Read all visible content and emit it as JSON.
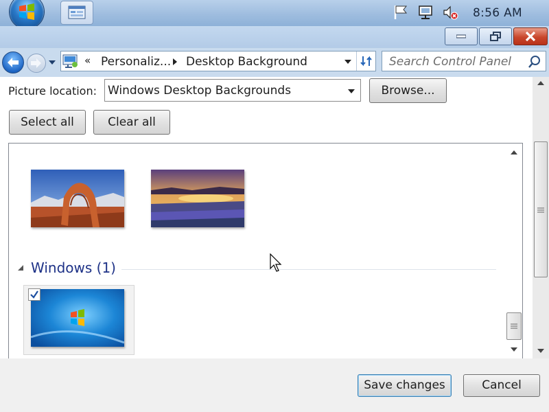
{
  "taskbar": {
    "clock": "8:56 AM",
    "start_icon": "windows-start-orb",
    "pinned_icon": "control-panel-window-icon",
    "tray_icons": [
      "flag-icon",
      "network-icon",
      "volume-muted-icon"
    ]
  },
  "window": {
    "minimize_icon": "minimize-icon",
    "maximize_icon": "restore-icon",
    "close_icon": "close-icon"
  },
  "address": {
    "overflow": "«",
    "segments": [
      "Personaliz...",
      "Desktop Background"
    ]
  },
  "search": {
    "placeholder": "Search Control Panel"
  },
  "picture_location": {
    "label": "Picture location:",
    "selected": "Windows Desktop Backgrounds"
  },
  "buttons": {
    "browse": "Browse...",
    "select_all": "Select all",
    "clear_all": "Clear all",
    "save": "Save changes",
    "cancel": "Cancel"
  },
  "gallery": {
    "thumbnails": [
      {
        "name": "arch-rock-desert"
      },
      {
        "name": "sunset-flower-field"
      }
    ],
    "group": {
      "title": "Windows (1)",
      "items": [
        {
          "name": "windows-7-default",
          "checked": true
        }
      ]
    }
  },
  "colors": {
    "group_title": "#1e3287",
    "taskbar": "#9fbddf",
    "close_button": "#c9472c"
  }
}
